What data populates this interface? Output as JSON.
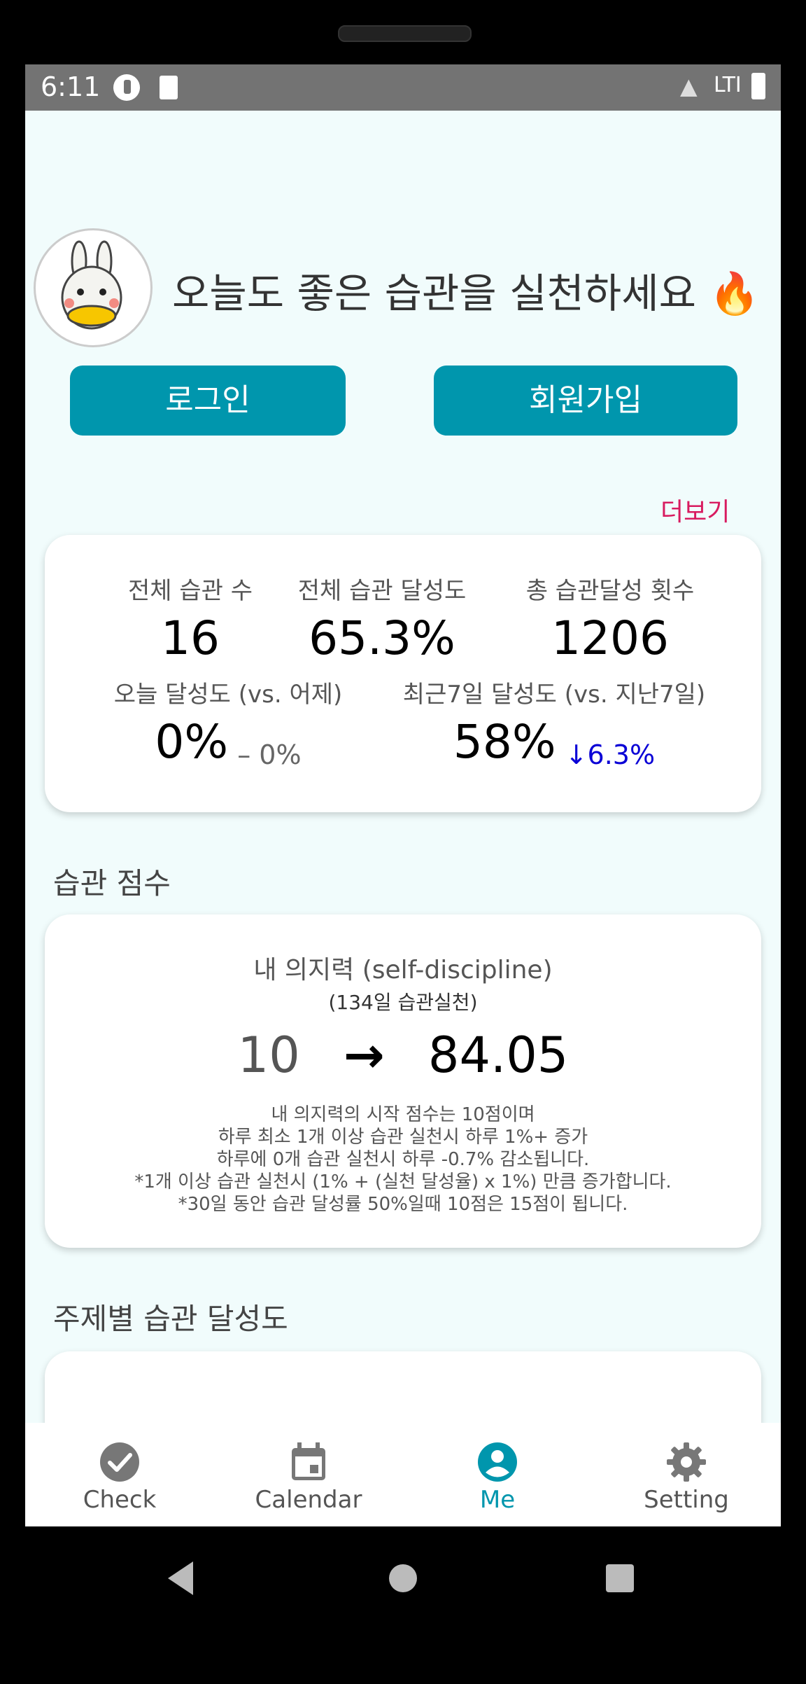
{
  "status_bar": {
    "time": "6:11",
    "network": "LTI"
  },
  "header": {
    "greeting": "오늘도 좋은 습관을 실천하세요",
    "greeting_emoji": "🔥",
    "login_label": "로그인",
    "signup_label": "회원가입"
  },
  "more_link": "더보기",
  "summary": {
    "total_habits_label": "전체 습관 수",
    "total_habits_value": "16",
    "total_rate_label": "전체 습관 달성도",
    "total_rate_value": "65.3%",
    "total_count_label": "총 습관달성 횟수",
    "total_count_value": "1206",
    "today_label": "오늘 달성도 (vs. 어제)",
    "today_value": "0%",
    "today_delta": "– 0%",
    "week_label": "최근7일 달성도 (vs. 지난7일)",
    "week_value": "58%",
    "week_delta": "↓6.3%"
  },
  "score_section": {
    "title": "습관 점수",
    "willpower_title": "내 의지력 (self-discipline)",
    "days_sub": "(134일 습관실천)",
    "start_score": "10",
    "arrow": "→",
    "current_score": "84.05",
    "desc_lines": [
      "내 의지력의 시작 점수는 10점이며",
      "하루 최소 1개 이상 습관 실천시 하루 1%+ 증가",
      "하루에 0개 습관 실천시 하루 -0.7% 감소됩니다.",
      "*1개 이상 습관 실천시 (1% + (실천 달성율) x 1%) 만큼 증가합니다.",
      "*30일 동안 습관 달성률 50%일때 10점은 15점이 됩니다."
    ]
  },
  "topic_section": {
    "title": "주제별 습관 달성도"
  },
  "nav": {
    "items": [
      {
        "label": "Check"
      },
      {
        "label": "Calendar"
      },
      {
        "label": "Me"
      },
      {
        "label": "Setting"
      }
    ],
    "active_color": "#0096ad"
  },
  "colors": {
    "accent": "#0096ad",
    "more": "#d81b60",
    "down": "#0a00d6"
  }
}
